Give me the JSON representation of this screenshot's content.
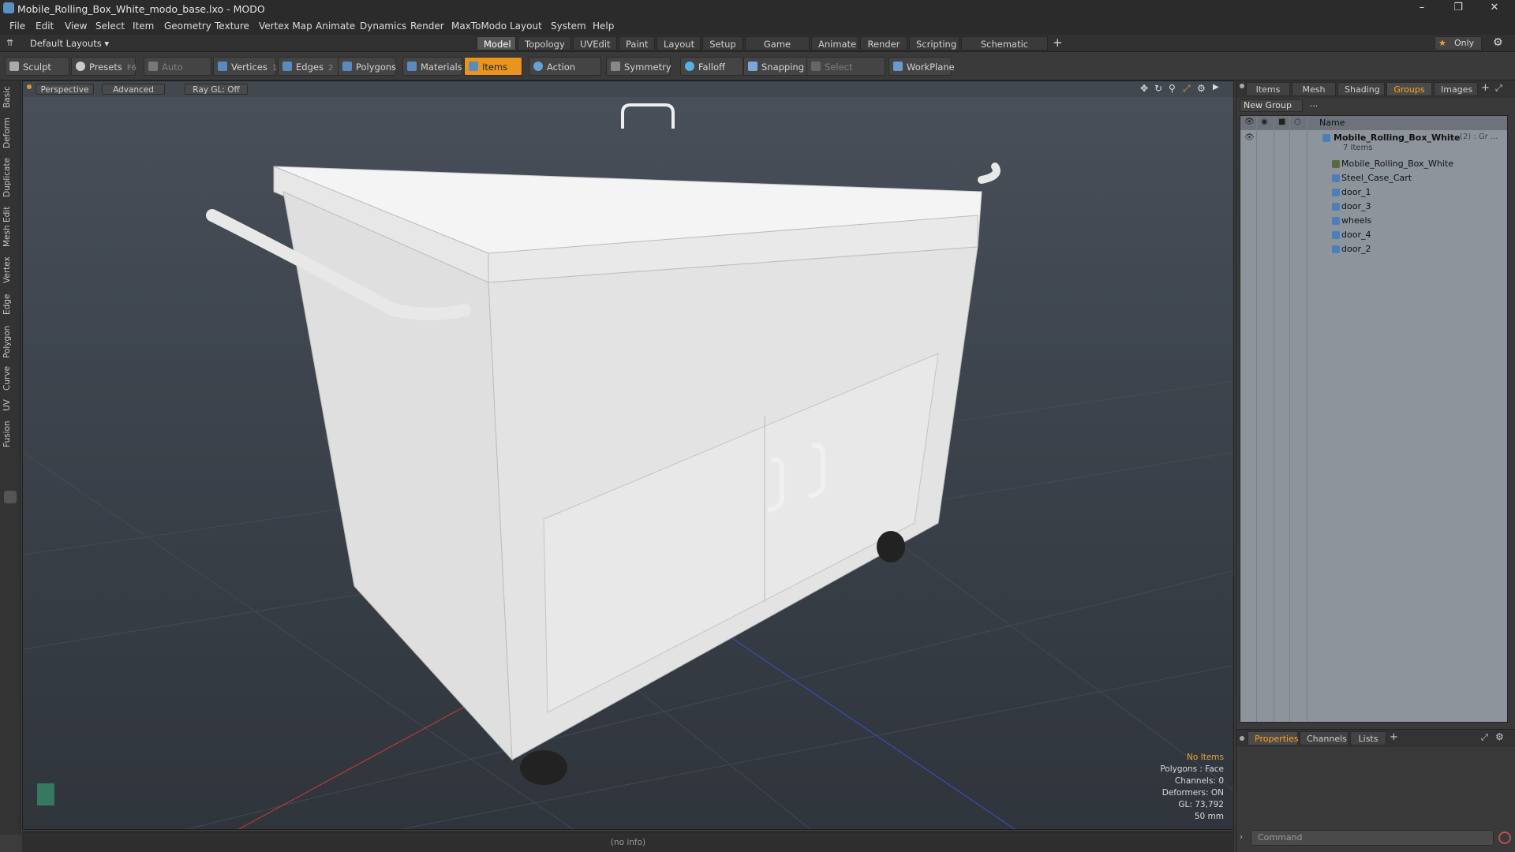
{
  "window": {
    "title": "Mobile_Rolling_Box_White_modo_base.lxo - MODO",
    "controls": [
      "minimize-icon",
      "restore-icon",
      "close-icon"
    ]
  },
  "menu": [
    "File",
    "Edit",
    "View",
    "Select",
    "Item",
    "Geometry",
    "Texture",
    "Vertex Map",
    "Animate",
    "Dynamics",
    "Render",
    "MaxToModo",
    "Layout",
    "System",
    "Help"
  ],
  "layout_bar": {
    "layout_selector": "Default Layouts",
    "tabs": [
      "Model",
      "Topology",
      "UVEdit",
      "Paint",
      "Layout",
      "Setup",
      "Game Tools",
      "Animate",
      "Render",
      "Scripting",
      "Schematic Fusion"
    ],
    "active_tab": "Model",
    "only_label": "Only"
  },
  "toolbar": {
    "sculpt": "Sculpt",
    "presets": "Presets",
    "presets_key": "F6",
    "auto_select": "Auto Select",
    "vertices": "Vertices",
    "vertices_num": "1",
    "edges": "Edges",
    "edges_num": "2",
    "polygons": "Polygons",
    "materials": "Materials",
    "items": "Items",
    "action_center": "Action Center",
    "symmetry": "Symmetry",
    "falloff": "Falloff",
    "snapping": "Snapping",
    "select_through": "Select Through",
    "workplane": "WorkPlane"
  },
  "left_tabs": [
    "Basic",
    "Deform",
    "Duplicate",
    "Mesh Edit",
    "Vertex",
    "Edge",
    "Polygon",
    "Curve",
    "UV",
    "Fusion"
  ],
  "viewport": {
    "view": "Perspective",
    "shading": "Advanced",
    "raygl": "Ray GL: Off",
    "info": {
      "selection": "No Items",
      "polygons": "Polygons : Face",
      "channels": "Channels: 0",
      "deformers": "Deformers: ON",
      "gl": "GL: 73,792",
      "focal": "50 mm"
    },
    "colors": {
      "axis_x": "#c83c3c",
      "axis_z": "#3c50c8",
      "accent": "#e8941d"
    }
  },
  "status": "(no info)",
  "right_panel": {
    "tabs": [
      "Items",
      "Mesh ...",
      "Shading",
      "Groups",
      "Images"
    ],
    "active_tab": "Groups",
    "new_group": "New Group",
    "column_name": "Name",
    "root": {
      "name": "Mobile_Rolling_Box_White",
      "suffix": "(2) : Gr ...",
      "count": "7 Items"
    },
    "children": [
      "Mobile_Rolling_Box_White",
      "Steel_Case_Cart",
      "door_1",
      "door_3",
      "wheels",
      "door_4",
      "door_2"
    ],
    "bottom_tabs": [
      "Properties",
      "Channels",
      "Lists"
    ],
    "bottom_active": "Properties",
    "command_placeholder": "Command"
  }
}
